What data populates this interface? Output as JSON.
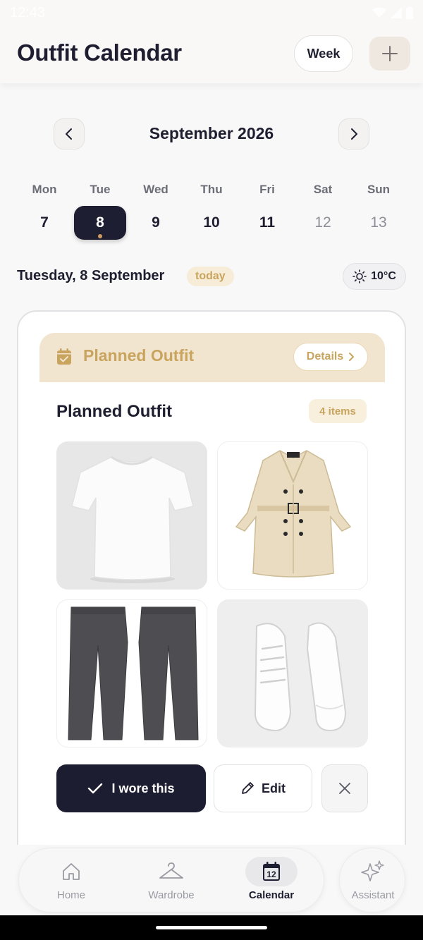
{
  "status_bar": {
    "time": "12:43"
  },
  "header": {
    "title": "Outfit Calendar",
    "week_label": "Week",
    "add_icon": "plus-icon"
  },
  "calendar": {
    "month_label": "September 2026",
    "prev_icon": "chevron-left-icon",
    "next_icon": "chevron-right-icon",
    "days": [
      {
        "name": "Mon",
        "num": "7"
      },
      {
        "name": "Tue",
        "num": "8",
        "selected": true,
        "has_event": true
      },
      {
        "name": "Wed",
        "num": "9"
      },
      {
        "name": "Thu",
        "num": "10"
      },
      {
        "name": "Fri",
        "num": "11"
      },
      {
        "name": "Sat",
        "num": "12",
        "muted": true
      },
      {
        "name": "Sun",
        "num": "13",
        "muted": true
      }
    ]
  },
  "date_line": {
    "date_text": "Tuesday, 8 September",
    "badge": "today",
    "weather": "10°C",
    "weather_icon": "sun-icon"
  },
  "outfit_card": {
    "banner_title": "Planned Outfit",
    "banner_icon": "calendar-check-icon",
    "details_label": "Details",
    "section_title": "Planned Outfit",
    "items_count": "4 items",
    "items": [
      {
        "name": "white-tshirt"
      },
      {
        "name": "beige-trench-coat"
      },
      {
        "name": "grey-trousers"
      },
      {
        "name": "white-sneakers"
      }
    ],
    "wore_label": "I wore this",
    "edit_label": "Edit"
  },
  "bottom_nav": {
    "items": [
      {
        "label": "Home",
        "icon": "home-icon"
      },
      {
        "label": "Wardrobe",
        "icon": "hanger-icon"
      },
      {
        "label": "Calendar",
        "icon": "calendar-icon",
        "icon_text": "12",
        "active": true
      }
    ],
    "assistant_label": "Assistant",
    "assistant_icon": "sparkle-icon"
  },
  "colors": {
    "accent": "#c9a45e",
    "dark": "#1e1e32",
    "banner": "#f1e5cf"
  }
}
